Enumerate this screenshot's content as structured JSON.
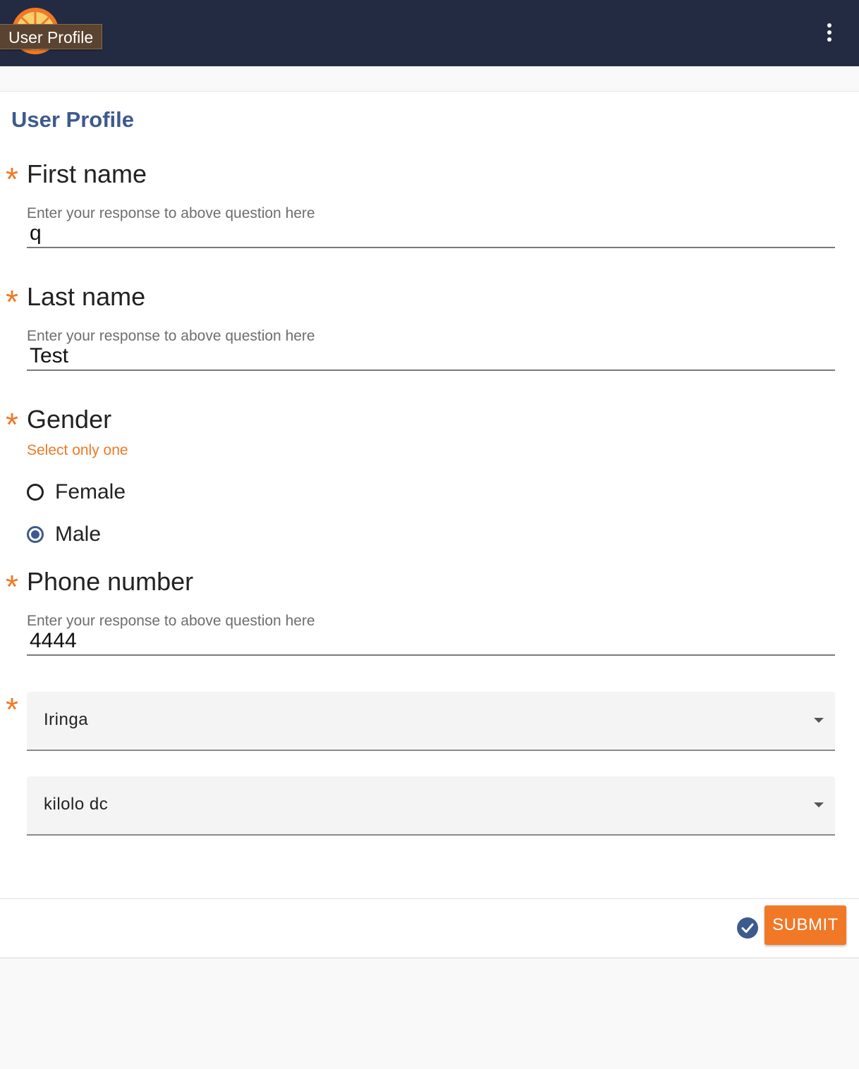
{
  "app_bar": {
    "tooltip": "User Profile",
    "logo_icon": "orange-slice-logo",
    "menu_icon": "more-vert-icon"
  },
  "form": {
    "title": "User Profile",
    "required_marker": "*",
    "questions": [
      {
        "label": "First name",
        "hint": "Enter your response to above question here",
        "value": "q"
      },
      {
        "label": "Last name",
        "hint": "Enter your response to above question here",
        "value": "Test"
      }
    ],
    "gender": {
      "label": "Gender",
      "hint": "Select only one",
      "options": [
        {
          "label": "Female",
          "selected": false
        },
        {
          "label": "Male",
          "selected": true
        }
      ]
    },
    "phone": {
      "label": "Phone number",
      "hint": "Enter your response to above question here",
      "value": "4444"
    },
    "region_select": {
      "value": "Iringa"
    },
    "district_select": {
      "value": "kilolo dc"
    }
  },
  "footer": {
    "submit_label": "SUBMIT",
    "status_icon": "check-circle-icon"
  },
  "colors": {
    "app_bar": "#222b41",
    "accent": "#f07826",
    "primary": "#3d5a8f"
  }
}
